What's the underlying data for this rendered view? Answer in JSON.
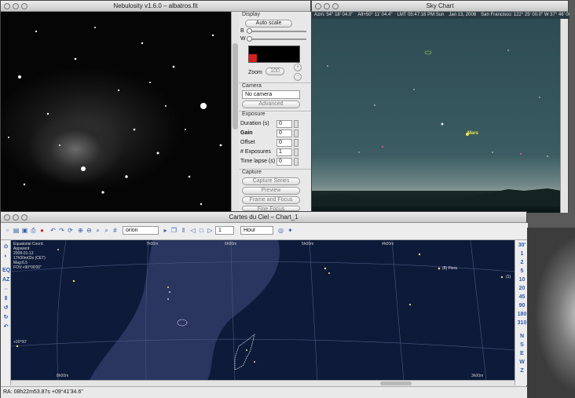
{
  "nebulosity": {
    "title": "Nebulosity v1.6.0 – albatros.fit",
    "panel": {
      "display_section": "Display",
      "auto_scale": "Auto scale",
      "b_label": "B",
      "w_label": "W",
      "zoom_label": "Zoom",
      "zoom_value": "100",
      "camera_section": "Camera",
      "camera_value": "No camera",
      "advanced_button": "Advanced",
      "exposure_section": "Exposure",
      "fields": [
        {
          "label": "Duration (s)",
          "value": "0"
        },
        {
          "label": "Gain",
          "value": "0"
        },
        {
          "label": "Offset",
          "value": "0"
        },
        {
          "label": "# Exposures",
          "value": "1"
        },
        {
          "label": "Time lapse (s)",
          "value": "0"
        }
      ],
      "capture_section": "Capture",
      "capture_buttons": [
        "Capture Series",
        "Preview",
        "Frame and Focus",
        "Fine Focus"
      ]
    }
  },
  "skychart": {
    "title": "Sky Chart",
    "status": [
      "Azm: 54° 18' 04.0\"",
      "Alt+50° 11' 04.4\"",
      "LMT 05:47:16 PM Sun",
      "Jan 13, 2008",
      "San Francisco: 122° 25' 00.0\" W 37° 46' 00"
    ],
    "planet_label": "Mars"
  },
  "cdc": {
    "title": "Cartes du Ciel – Chart_1",
    "toolbar": {
      "object_select": "orion",
      "step_value": "1",
      "unit_select": "Hour"
    },
    "map_info": [
      "Equatorial Coord.",
      "Apparent",
      "2008-01-13",
      "17h00m02s (CET)",
      "Mag:6.5",
      "FOV:+90°00'00\""
    ],
    "ra_labels": [
      "7h00m",
      "6h00m",
      "5h00m",
      "4h00m",
      "8h00m",
      "3h00m"
    ],
    "dec_label": "+00°00'",
    "object_labels": [
      "(8) Flora",
      "(1)"
    ],
    "left_tools": [
      "EQ",
      "AZ"
    ],
    "fov_buttons": [
      "30'",
      "1",
      "2",
      "5",
      "10",
      "20",
      "45",
      "90",
      "180",
      "310"
    ],
    "direction_buttons": [
      "N",
      "S",
      "E",
      "W",
      "Z"
    ],
    "status": "RA: 08h22m53.87s +09°41'34.6\""
  }
}
